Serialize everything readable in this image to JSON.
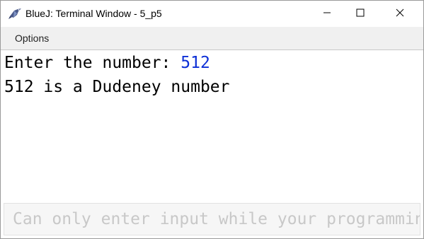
{
  "window": {
    "title": "BlueJ: Terminal Window - 5_p5",
    "icon": "bluej-bird-icon"
  },
  "titlebar_buttons": {
    "minimize_icon": "minimize-icon",
    "maximize_icon": "maximize-icon",
    "close_icon": "close-icon"
  },
  "menu": {
    "options_label": "Options"
  },
  "console": {
    "prompt": "Enter the number: ",
    "user_input": "512",
    "output_line": "512 is a Dudeney number"
  },
  "input_bar": {
    "placeholder": "Can only enter input while your programming is running"
  },
  "colors": {
    "user_input": "#0d2fd6",
    "menubar_bg": "#f0f0f0",
    "placeholder": "#c8c8c8"
  }
}
